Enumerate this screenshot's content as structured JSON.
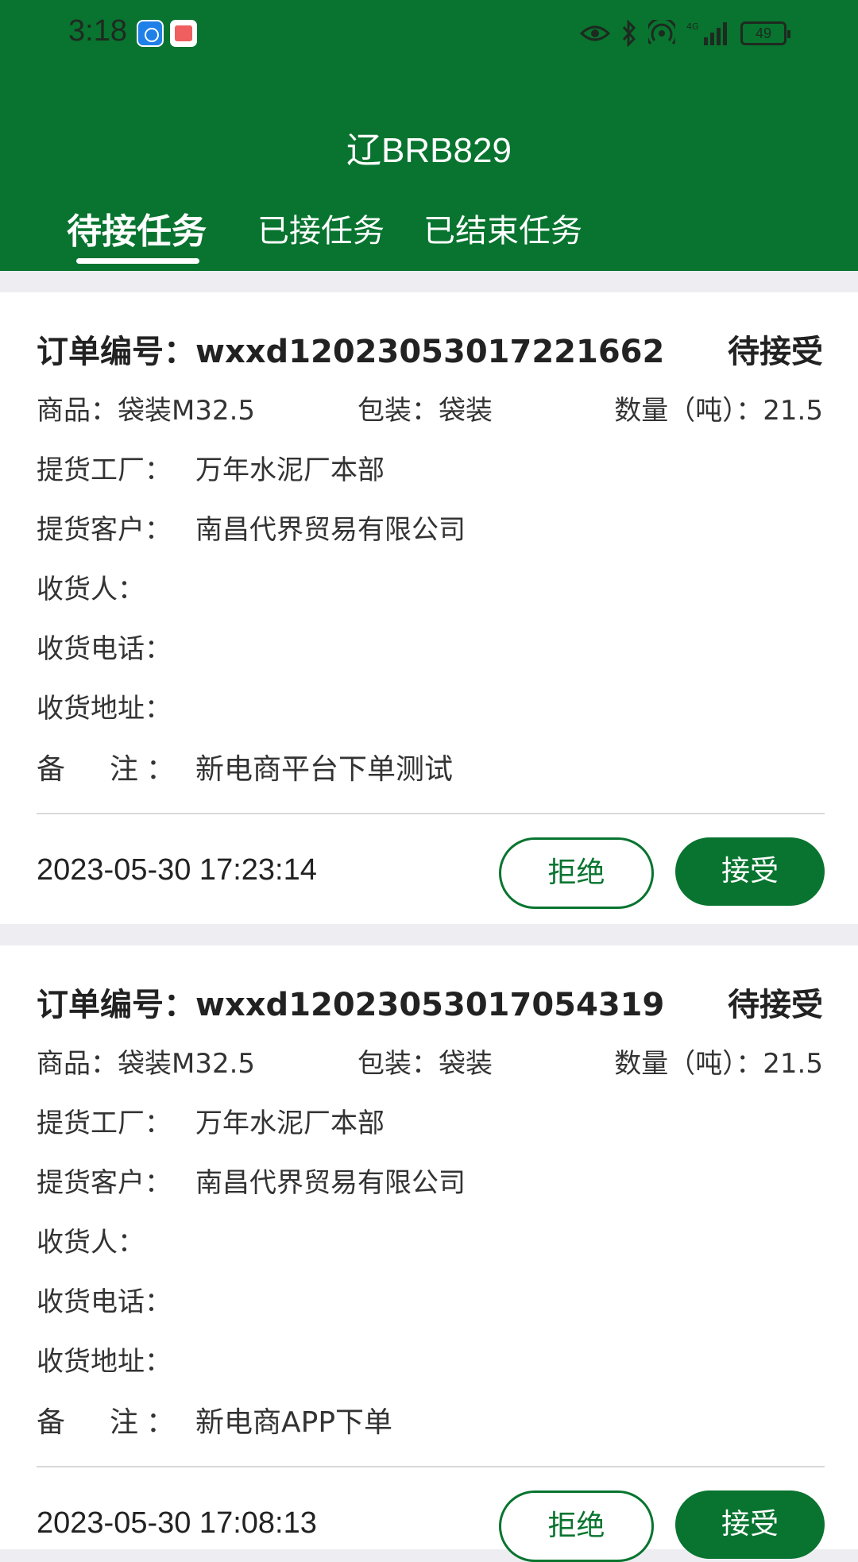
{
  "status_bar": {
    "time": "3:18",
    "battery": "49"
  },
  "header": {
    "title": "辽BRB829",
    "tabs": [
      "待接任务",
      "已接任务",
      "已结束任务"
    ],
    "active_tab": 0
  },
  "orders": [
    {
      "order_label": "订单编号：",
      "order_no": "wxxd12023053017221662",
      "status": "待接受",
      "goods": "商品：袋装M32.5",
      "package": "包装：袋装",
      "quantity": "数量（吨）：21.5",
      "factory_label": "提货工厂：",
      "factory": "万年水泥厂本部",
      "customer_label": "提货客户：",
      "customer": "南昌代界贸易有限公司",
      "receiver_label": "收货人：",
      "phone_label": "收货电话：",
      "address_label": "收货地址：",
      "remark_label": "备　注：",
      "remark": "新电商平台下单测试",
      "timestamp": "2023-05-30 17:23:14",
      "reject": "拒绝",
      "accept": "接受"
    },
    {
      "order_label": "订单编号：",
      "order_no": "wxxd12023053017054319",
      "status": "待接受",
      "goods": "商品：袋装M32.5",
      "package": "包装：袋装",
      "quantity": "数量（吨）：21.5",
      "factory_label": "提货工厂：",
      "factory": "万年水泥厂本部",
      "customer_label": "提货客户：",
      "customer": "南昌代界贸易有限公司",
      "receiver_label": "收货人：",
      "phone_label": "收货电话：",
      "address_label": "收货地址：",
      "remark_label": "备　注：",
      "remark": "新电商APP下单",
      "timestamp": "2023-05-30 17:08:13",
      "reject": "拒绝",
      "accept": "接受"
    }
  ],
  "colors": {
    "brand": "#08742f",
    "background": "#eeeef2"
  }
}
